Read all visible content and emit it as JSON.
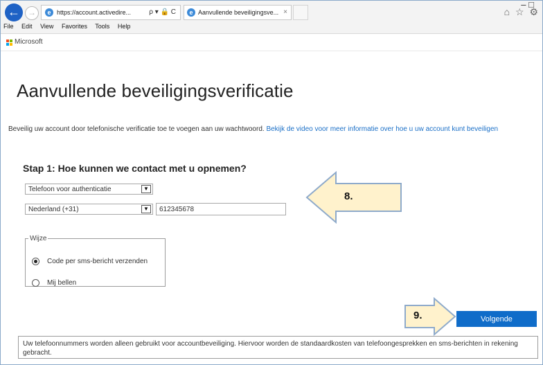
{
  "browser": {
    "url": "https://account.activedire...",
    "addr_controls": "ρ ▾ 🔒 C",
    "tab_title": "Aanvullende beveiligingsve...",
    "tab_close": "×",
    "window_caption": "–  □",
    "toolbar_icons": "⌂ ☆ ⚙",
    "menu": [
      "File",
      "Edit",
      "View",
      "Favorites",
      "Tools",
      "Help"
    ]
  },
  "brand": {
    "name": "Microsoft",
    "colors": [
      "#f25022",
      "#7fba00",
      "#00a4ef",
      "#ffb900"
    ]
  },
  "page": {
    "title": "Aanvullende beveiligingsverificatie",
    "description": "Beveilig uw account door telefonische verificatie toe te voegen aan uw wachtwoord.",
    "description_link": "Bekijk de video voor meer informatie over hoe u uw account kunt beveiligen",
    "step_heading": "Stap 1: Hoe kunnen we contact met u opnemen?",
    "method_select": "Telefoon voor authenticatie",
    "country_select": "Nederland (+31)",
    "phone_value": "612345678",
    "mode_legend": "Wijze",
    "options": [
      {
        "label": "Code per sms-bericht verzenden",
        "selected": true
      },
      {
        "label": "Mij bellen",
        "selected": false
      }
    ],
    "next_button": "Volgende",
    "note": "Uw telefoonnummers worden alleen gebruikt voor accountbeveiliging. Hiervoor worden de standaardkosten van telefoongesprekken en sms-berichten in rekening gebracht."
  },
  "callouts": {
    "step8": "8.",
    "step9": "9.",
    "fill": "#fff2cc",
    "stroke": "#8eaacb"
  },
  "colors": {
    "accent": "#0f6cc9",
    "link": "#1a6fc7"
  }
}
